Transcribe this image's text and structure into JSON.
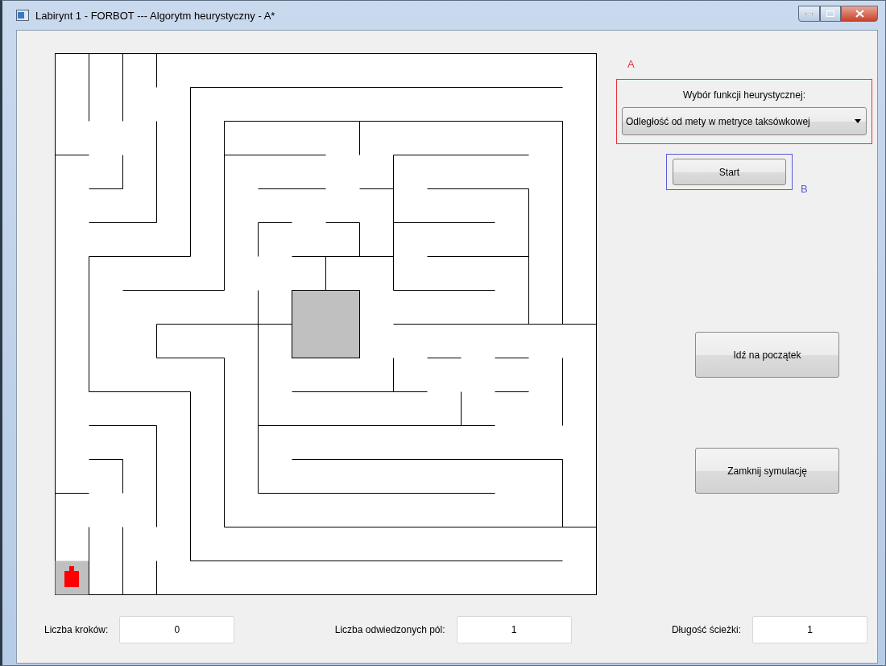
{
  "window": {
    "title": "Labirynt 1 - FORBOT --- Algorytm heurystyczny - A*"
  },
  "annotations": [
    {
      "label": "A",
      "color": "#e8323c"
    },
    {
      "label": "B",
      "color": "#5a5ad8"
    }
  ],
  "heuristic": {
    "label": "Wybór funkcji heurystycznej:",
    "value": "Odległość od mety w metryce taksówkowej"
  },
  "start_button": "Start",
  "buttons": [
    "Idź na początek",
    "Zamknij symulację"
  ],
  "stats": [
    {
      "label": "Liczba kroków:",
      "value": "0"
    },
    {
      "label": "Liczba odwiedzonych pól:",
      "value": "1"
    },
    {
      "label": "Długość ścieżki:",
      "value": "1"
    }
  ]
}
